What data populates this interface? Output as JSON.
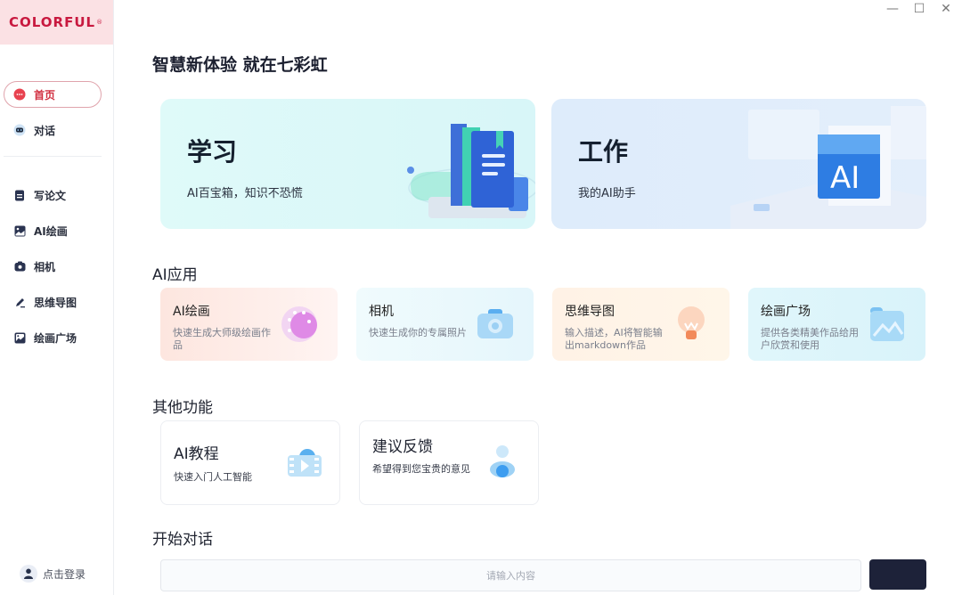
{
  "app": {
    "brand": "COLORFUL",
    "brand_mark": "®"
  },
  "window_controls": {
    "minimize": "—",
    "maximize": "☐",
    "close": "✕"
  },
  "sidebar": {
    "primary": [
      {
        "label": "首页",
        "icon": "chat-bubble-icon",
        "active": true
      },
      {
        "label": "对话",
        "icon": "robot-icon",
        "active": false
      }
    ],
    "secondary": [
      {
        "label": "写论文",
        "icon": "document-icon"
      },
      {
        "label": "AI绘画",
        "icon": "image-icon"
      },
      {
        "label": "相机",
        "icon": "camera-icon"
      },
      {
        "label": "思维导图",
        "icon": "pen-icon"
      },
      {
        "label": "绘画广场",
        "icon": "gallery-icon"
      }
    ],
    "login_label": "点击登录"
  },
  "main": {
    "hero_title": "智慧新体验 就在七彩虹",
    "hero_cards": [
      {
        "title": "学习",
        "subtitle": "AI百宝箱，知识不恐慌"
      },
      {
        "title": "工作",
        "subtitle": "我的AI助手"
      }
    ],
    "ai_apps_title": "AI应用",
    "ai_apps": [
      {
        "title": "AI绘画",
        "desc": "快速生成大师级绘画作品"
      },
      {
        "title": "相机",
        "desc": "快速生成你的专属照片"
      },
      {
        "title": "思维导图",
        "desc": "输入描述，AI将智能输出markdown作品"
      },
      {
        "title": "绘画广场",
        "desc": "提供各类精美作品给用户欣赏和使用"
      }
    ],
    "other_title": "其他功能",
    "other": [
      {
        "title": "AI教程",
        "desc": "快速入门人工智能"
      },
      {
        "title": "建议反馈",
        "desc": "希望得到您宝贵的意见"
      }
    ],
    "chat_title": "开始对话",
    "chat_placeholder": "请输入内容",
    "send_label": ""
  },
  "colors": {
    "brand": "#c8193f",
    "active": "#d12e3f",
    "send": "#1d2239"
  }
}
